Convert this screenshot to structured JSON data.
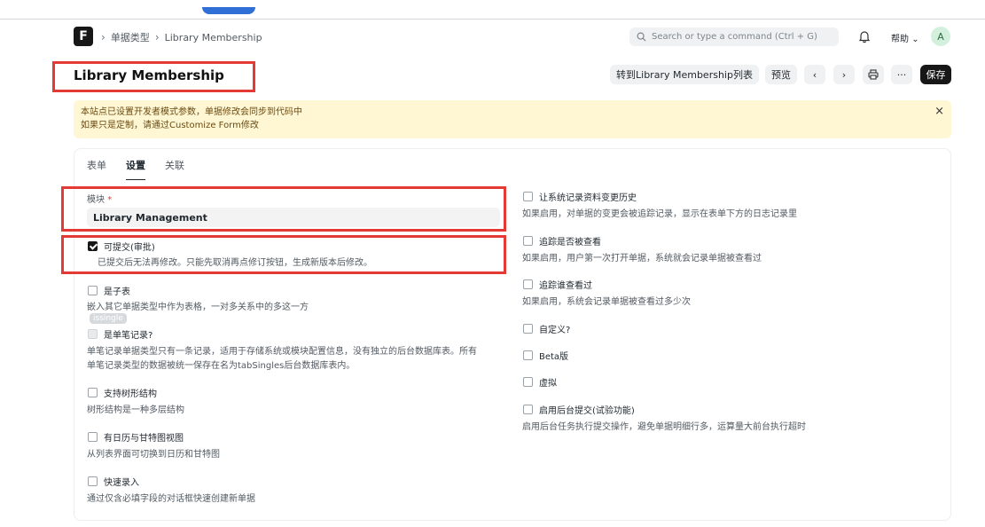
{
  "navbar": {
    "logo_letter": "F",
    "breadcrumbs": [
      "单据类型",
      "Library Membership"
    ],
    "search_placeholder": "Search or type a command (Ctrl + G)",
    "help_label": "帮助",
    "avatar_initial": "A"
  },
  "page": {
    "title": "Library Membership"
  },
  "toolbar": {
    "list_label": "转到Library Membership列表",
    "preview_label": "预览",
    "prev_glyph": "‹",
    "next_glyph": "›",
    "more_glyph": "···",
    "save_label": "保存"
  },
  "banner": {
    "line1": "本站点已设置开发者模式参数，单据修改会同步到代码中",
    "line2": "如果只是定制，请通过Customize Form修改",
    "close_glyph": "×"
  },
  "tabs": [
    {
      "label": "表单",
      "active": false
    },
    {
      "label": "设置",
      "active": true
    },
    {
      "label": "关联",
      "active": false
    }
  ],
  "left": {
    "module_label": "模块",
    "required_mark": "*",
    "module_value": "Library Management",
    "submittable_label": "可提交(审批)",
    "submittable_help": "已提交后无法再修改。只能先取消再点修订按钮，生成新版本后修改。",
    "child_table_label": "是子表",
    "child_table_help": "嵌入其它单据类型中作为表格，一对多关系中的多这一方",
    "tooltip": "issingle",
    "single_label": "是单笔记录?",
    "single_help_1": "单笔记录单据类型只有一条记录，适用于存储系统或模块配置信息，没有独立的后台数据库表。所有",
    "single_help_2": "单笔记录类型的数据被统一保存在名为tabSingles后台数据库表内。",
    "tree_label": "支持树形结构",
    "tree_help": "树形结构是一种多层结构",
    "calendar_label": "有日历与甘特图视图",
    "calendar_help": "从列表界面可切换到日历和甘特图",
    "quick_entry_label": "快速录入",
    "quick_entry_help": "通过仅含必填字段的对话框快速创建新单据"
  },
  "right": {
    "track_changes_label": "让系统记录资料变更历史",
    "track_changes_help": "如果启用，对单据的变更会被追踪记录，显示在表单下方的日志记录里",
    "track_seen_label": "追踪是否被查看",
    "track_seen_help": "如果启用，用户第一次打开单据，系统就会记录单据被查看过",
    "track_views_label": "追踪谁查看过",
    "track_views_help": "如果启用，系统会记录单据被查看过多少次",
    "custom_label": "自定义?",
    "beta_label": "Beta版",
    "virtual_label": "虚拟",
    "queue_label": "启用后台提交(试验功能)",
    "queue_help": "启用后台任务执行提交操作，避免单据明细行多，运算量大前台执行超时"
  }
}
